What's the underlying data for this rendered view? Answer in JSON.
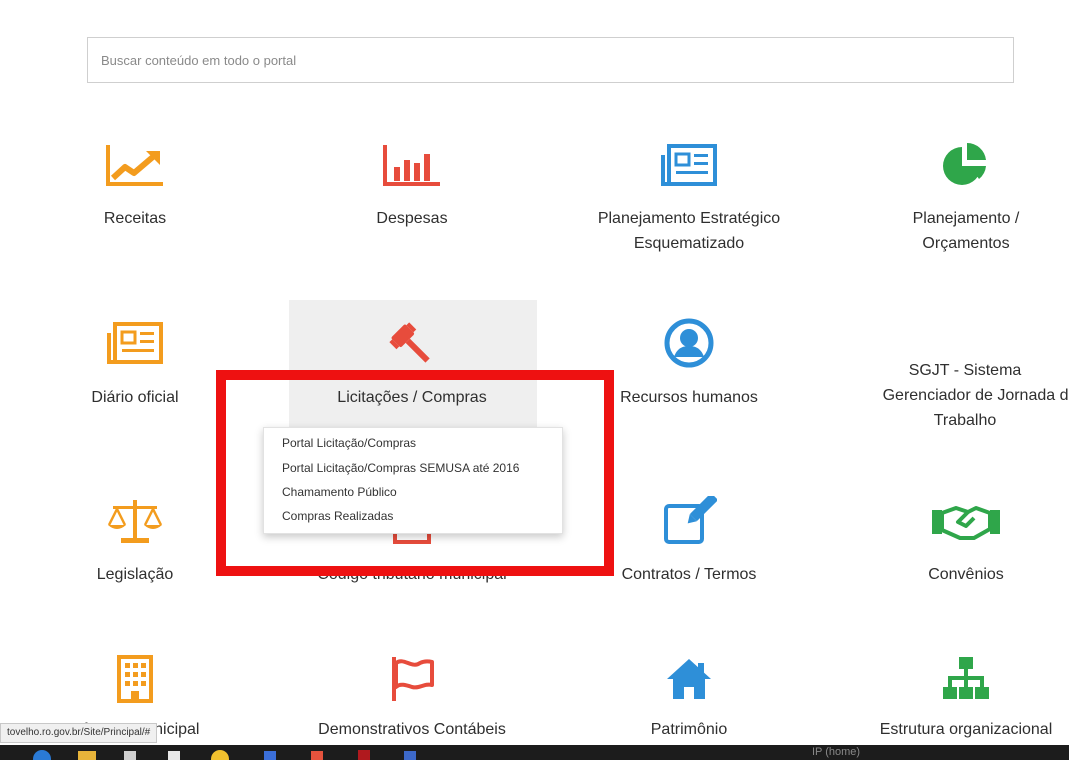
{
  "search": {
    "placeholder": "Buscar conteúdo em todo o portal"
  },
  "tiles": {
    "receitas": "Receitas",
    "despesas": "Despesas",
    "planejamento_estrategico": [
      "Planejamento Estratégico",
      "Esquematizado"
    ],
    "planejamento_orcamentos": [
      "Planejamento /",
      "Orçamentos"
    ],
    "diario_oficial": "Diário oficial",
    "licitacoes_compras": "Licitações / Compras",
    "recursos_humanos": "Recursos humanos",
    "sgjt": [
      "SGJT - Sistema",
      "Gerenciador de Jornada de",
      "Trabalho"
    ],
    "legislacao": "Legislação",
    "codigo_tributario": "Código tributário municipal",
    "contratos_termos": "Contratos / Termos",
    "convenios": "Convênios",
    "camara_municipal": "Câmara municipal",
    "demonstrativos_contabeis": "Demonstrativos Contábeis",
    "patrimonio": "Patrimônio",
    "estrutura_organizacional": "Estrutura organizacional"
  },
  "dropdown": {
    "items": [
      "Portal Licitação/Compras",
      "Portal Licitação/Compras SEMUSA até 2016",
      "Chamamento Público",
      "Compras Realizadas"
    ]
  },
  "status_url": "tovelho.ro.gov.br/Site/Principal/#",
  "taskbar_text": "IP (home)",
  "colors": {
    "orange": "#f39c1e",
    "red": "#e74c3c",
    "blue": "#2e8fd8",
    "green": "#2fa64a",
    "highlight": "#ee1111"
  },
  "icons": [
    "chart-line-icon",
    "bar-chart-icon",
    "newspaper-icon",
    "pie-chart-icon",
    "newspaper-icon",
    "gavel-icon",
    "user-circle-icon",
    "scale-icon",
    "edit-icon",
    "handshake-icon",
    "building-icon",
    "flag-icon",
    "home-icon",
    "sitemap-icon"
  ]
}
